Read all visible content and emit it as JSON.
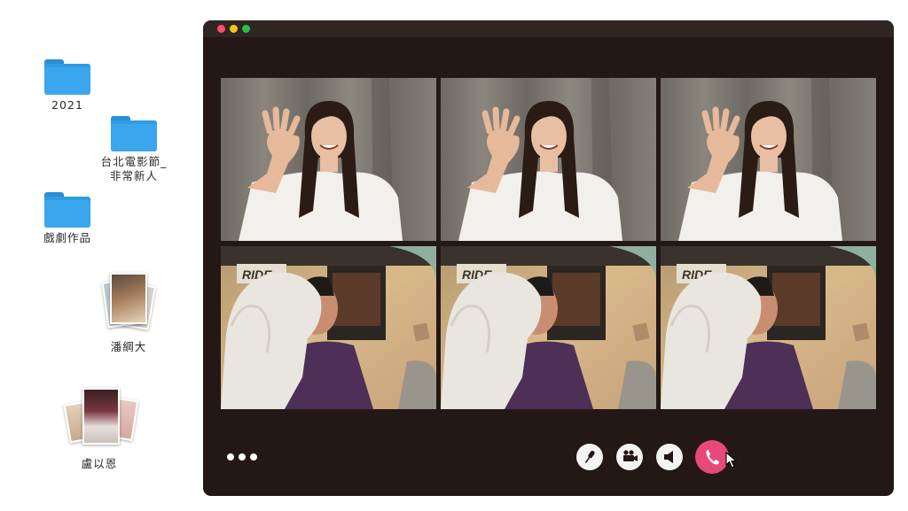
{
  "desktop": {
    "items": [
      {
        "label": "2021",
        "icon": "folder-icon"
      },
      {
        "label": "台北電影節_\n非常新人",
        "icon": "folder-icon"
      },
      {
        "label": "戲劇作品",
        "icon": "folder-icon"
      },
      {
        "label": "潘綱大",
        "icon": "photo-stack-icon"
      },
      {
        "label": "盧以恩",
        "icon": "photo-stack-icon"
      }
    ]
  },
  "window": {
    "traffic_lights": [
      "#ff4f66",
      "#f4c51b",
      "#27c246"
    ],
    "background": "#231815"
  },
  "video_grid": {
    "tiles": [
      {
        "participant": "woman-waving"
      },
      {
        "participant": "woman-waving"
      },
      {
        "participant": "woman-waving"
      },
      {
        "participant": "man-with-dog",
        "sign_text": "RIDE"
      },
      {
        "participant": "man-with-dog",
        "sign_text": "RIDE"
      },
      {
        "participant": "man-with-dog",
        "sign_text": "RIDE"
      }
    ]
  },
  "controls": {
    "more_icon": "more-dots-icon",
    "buttons": [
      {
        "name": "microphone",
        "icon": "microphone-icon"
      },
      {
        "name": "camera",
        "icon": "video-camera-icon"
      },
      {
        "name": "speaker",
        "icon": "speaker-icon"
      },
      {
        "name": "end-call",
        "icon": "phone-icon",
        "color": "#e6497a"
      }
    ]
  }
}
